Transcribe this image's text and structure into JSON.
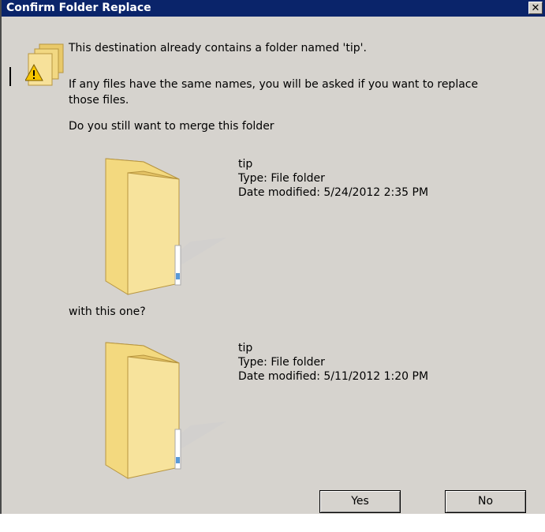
{
  "window": {
    "title": "Confirm Folder Replace",
    "close_glyph": "✕"
  },
  "message": {
    "line1": "This destination already contains a folder named 'tip'.",
    "line2a": "If any files have the same names, you will be asked if you want to replace",
    "line2b": "those files.",
    "line3": "Do you still want to merge this folder",
    "with_label": "with this one?"
  },
  "source_folder": {
    "name": "tip",
    "type": "Type: File folder",
    "modified": "Date modified: 5/24/2012 2:35 PM"
  },
  "target_folder": {
    "name": "tip",
    "type": "Type: File folder",
    "modified": "Date modified: 5/11/2012 1:20 PM"
  },
  "buttons": {
    "yes": "Yes",
    "no": "No"
  },
  "colors": {
    "titlebar": "#0a246a",
    "dialog_bg": "#d6d3ce",
    "folder_front": "#f5dc8a",
    "folder_back": "#e9c96a"
  },
  "icons": [
    "warning-folder-icon",
    "folder-icon",
    "close-icon"
  ]
}
